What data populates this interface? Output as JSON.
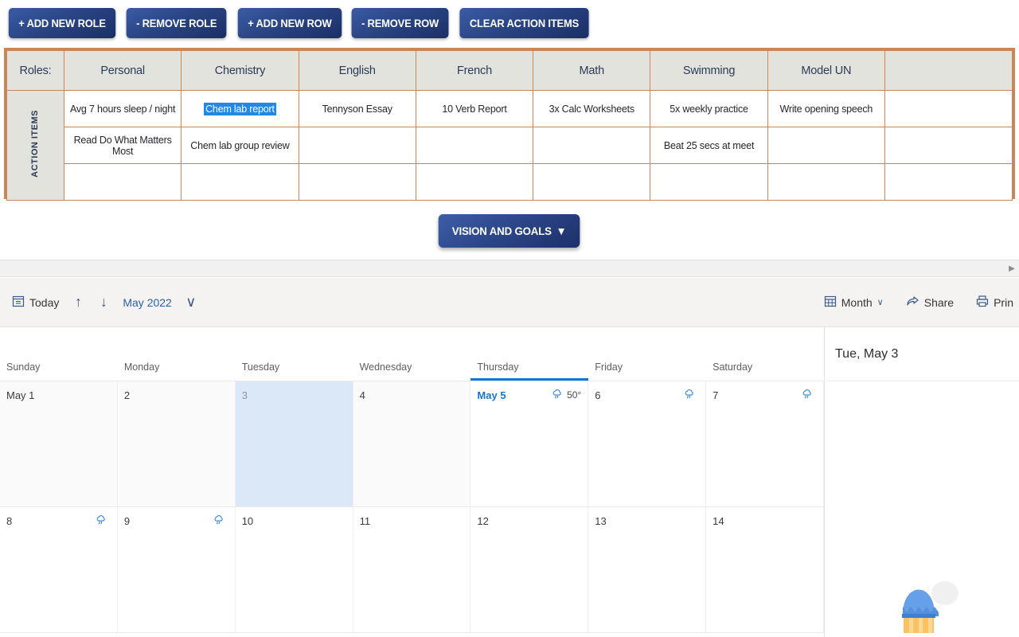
{
  "toolbar": {
    "buttons": [
      {
        "label": "+ ADD NEW ROLE",
        "name": "add-new-role-button"
      },
      {
        "label": "- REMOVE ROLE",
        "name": "remove-role-button"
      },
      {
        "label": "+ ADD NEW ROW",
        "name": "add-new-row-button"
      },
      {
        "label": "- REMOVE ROW",
        "name": "remove-row-button"
      },
      {
        "label": "CLEAR ACTION ITEMS",
        "name": "clear-action-items-button"
      }
    ]
  },
  "roles_table": {
    "roles_label": "Roles:",
    "side_label": "ACTION ITEMS",
    "columns": [
      "Personal",
      "Chemistry",
      "English",
      "French",
      "Math",
      "Swimming",
      "Model UN",
      ""
    ],
    "rows": [
      {
        "cells": [
          {
            "text": "Avg 7 hours sleep / night",
            "selected": false
          },
          {
            "text": "Chem lab report",
            "selected": true
          },
          {
            "text": "Tennyson Essay",
            "selected": false
          },
          {
            "text": "10 Verb Report",
            "selected": false
          },
          {
            "text": "3x Calc Worksheets",
            "selected": false
          },
          {
            "text": "5x weekly practice",
            "selected": false
          },
          {
            "text": "Write opening speech",
            "selected": false
          },
          {
            "text": "",
            "selected": false
          }
        ]
      },
      {
        "cells": [
          {
            "text": "Read Do What Matters Most",
            "selected": false
          },
          {
            "text": "Chem lab group review",
            "selected": false
          },
          {
            "text": "",
            "selected": false
          },
          {
            "text": "",
            "selected": false
          },
          {
            "text": "",
            "selected": false
          },
          {
            "text": "Beat 25 secs at meet",
            "selected": false
          },
          {
            "text": "",
            "selected": false
          },
          {
            "text": "",
            "selected": false
          }
        ]
      },
      {
        "cells": [
          {
            "text": "",
            "selected": false
          },
          {
            "text": "",
            "selected": false
          },
          {
            "text": "",
            "selected": false
          },
          {
            "text": "",
            "selected": false
          },
          {
            "text": "",
            "selected": false
          },
          {
            "text": "",
            "selected": false
          },
          {
            "text": "",
            "selected": false
          },
          {
            "text": "",
            "selected": false
          }
        ]
      }
    ],
    "border_color": "#c8875a",
    "header_bg": "#e3e3de",
    "selection_color": "#2288e8"
  },
  "vision": {
    "label": "VISION AND GOALS",
    "caret": "▼"
  },
  "calendar_toolbar": {
    "today_label": "Today",
    "prev_label": "↑",
    "next_label": "↓",
    "month_value": "May 2022",
    "month_caret": "∨",
    "view_label": "Month",
    "view_caret": "∨",
    "share_label": "Share",
    "print_label": "Prin"
  },
  "calendar": {
    "daynames": [
      "Sunday",
      "Monday",
      "Tuesday",
      "Wednesday",
      "Thursday",
      "Friday",
      "Saturday"
    ],
    "today_column_index": 4,
    "weeks": [
      [
        {
          "num": "May 1",
          "style": "normal",
          "bg": "alt",
          "weather": null
        },
        {
          "num": "2",
          "style": "normal",
          "bg": "alt",
          "weather": null
        },
        {
          "num": "3",
          "style": "muted",
          "bg": "selected",
          "weather": null
        },
        {
          "num": "4",
          "style": "normal",
          "bg": "alt",
          "weather": null
        },
        {
          "num": "May 5",
          "style": "today",
          "bg": "white",
          "weather": {
            "icon": "rain-cloud",
            "temp": "50°"
          }
        },
        {
          "num": "6",
          "style": "normal",
          "bg": "white",
          "weather": {
            "icon": "rain-cloud",
            "temp": ""
          }
        },
        {
          "num": "7",
          "style": "normal",
          "bg": "white",
          "weather": {
            "icon": "rain-cloud",
            "temp": ""
          }
        }
      ],
      [
        {
          "num": "8",
          "style": "normal",
          "bg": "white",
          "weather": {
            "icon": "rain-cloud",
            "temp": ""
          }
        },
        {
          "num": "9",
          "style": "normal",
          "bg": "white",
          "weather": {
            "icon": "rain-cloud",
            "temp": ""
          }
        },
        {
          "num": "10",
          "style": "normal",
          "bg": "white",
          "weather": null
        },
        {
          "num": "11",
          "style": "normal",
          "bg": "white",
          "weather": null
        },
        {
          "num": "12",
          "style": "normal",
          "bg": "white",
          "weather": null
        },
        {
          "num": "13",
          "style": "normal",
          "bg": "white",
          "weather": null
        },
        {
          "num": "14",
          "style": "normal",
          "bg": "white",
          "weather": null
        }
      ]
    ],
    "today_color": "#1775d1",
    "selected_bg": "#dbe8f7"
  },
  "right_panel": {
    "title": "Tue, May 3"
  }
}
